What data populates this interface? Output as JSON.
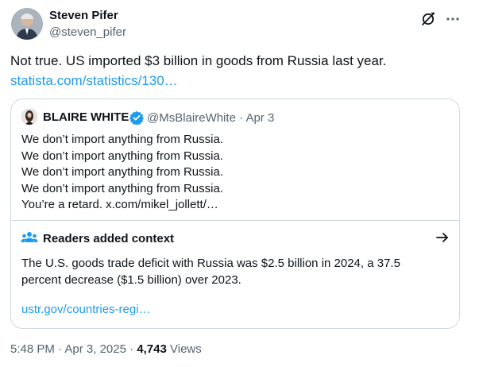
{
  "tweet": {
    "author_name": "Steven Pifer",
    "author_handle": "@steven_pifer",
    "text": "Not true. US imported $3 billion in goods from Russia last year.",
    "link": "statista.com/statistics/130…"
  },
  "quote": {
    "author_name": "BLAIRE WHITE",
    "author_handle": "@MsBlaireWhite",
    "separator": "·",
    "date": "Apr 3",
    "lines": [
      "We don’t import anything from Russia.",
      "We don’t import anything from Russia.",
      "We don’t import anything from Russia.",
      "We don’t import anything from Russia.",
      "You’re a retard. x.com/mikel_jollett/…"
    ]
  },
  "community_note": {
    "title": "Readers added context",
    "lines": [
      "The U.S. goods trade deficit with Russia was $2.5 billion in 2024, a 37.5",
      "percent decrease ($1.5 billion) over 2023."
    ],
    "link": "ustr.gov/countries-regi…"
  },
  "footer": {
    "time": "5:48 PM",
    "separator": "·",
    "date": "Apr 3, 2025",
    "views_count": "4,743",
    "views_label": "Views"
  },
  "colors": {
    "link": "#1d9bf0",
    "secondary_text": "#536471",
    "verified": "#1d9bf0",
    "border": "#cfd9de"
  },
  "icons": {
    "grok": "grok-icon",
    "more": "more-icon",
    "verified": "verified-badge-icon",
    "community_notes": "people-icon",
    "arrow": "arrow-right-icon"
  }
}
